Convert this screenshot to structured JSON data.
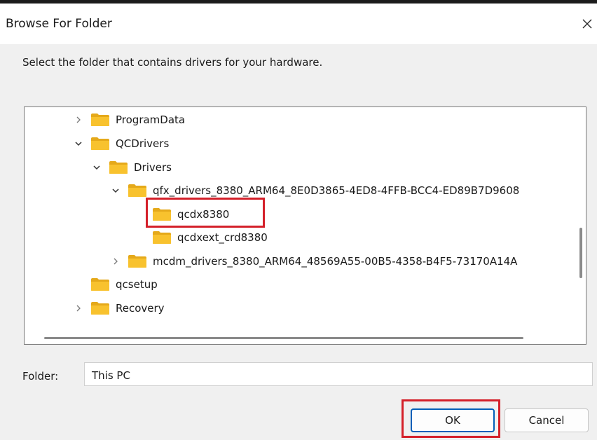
{
  "window": {
    "title": "Browse For Folder",
    "close_glyph": "✕"
  },
  "instruction": "Select the folder that contains drivers for your hardware.",
  "tree": [
    {
      "label": "ProgramData",
      "chevron": "right",
      "depth": 0
    },
    {
      "label": "QCDrivers",
      "chevron": "down",
      "depth": 0
    },
    {
      "label": "Drivers",
      "chevron": "down",
      "depth": 1
    },
    {
      "label": "qfx_drivers_8380_ARM64_8E0D3865-4ED8-4FFB-BCC4-ED89B7D9608",
      "chevron": "down",
      "depth": 2
    },
    {
      "label": "qcdx8380",
      "chevron": "none",
      "depth": 3,
      "highlighted": true
    },
    {
      "label": "qcdxext_crd8380",
      "chevron": "none",
      "depth": 3
    },
    {
      "label": "mcdm_drivers_8380_ARM64_48569A55-00B5-4358-B4F5-73170A14A",
      "chevron": "right",
      "depth": 2
    },
    {
      "label": "qcsetup",
      "chevron": "none",
      "depth": 0
    },
    {
      "label": "Recovery",
      "chevron": "right",
      "depth": 0
    }
  ],
  "folder_field": {
    "label": "Folder:",
    "value": "This PC"
  },
  "buttons": {
    "ok": "OK",
    "cancel": "Cancel"
  },
  "colors": {
    "folder": "#f8c22e",
    "folder_dark": "#e5a91a",
    "highlight": "#d4202a",
    "ok_border": "#005fb8"
  }
}
